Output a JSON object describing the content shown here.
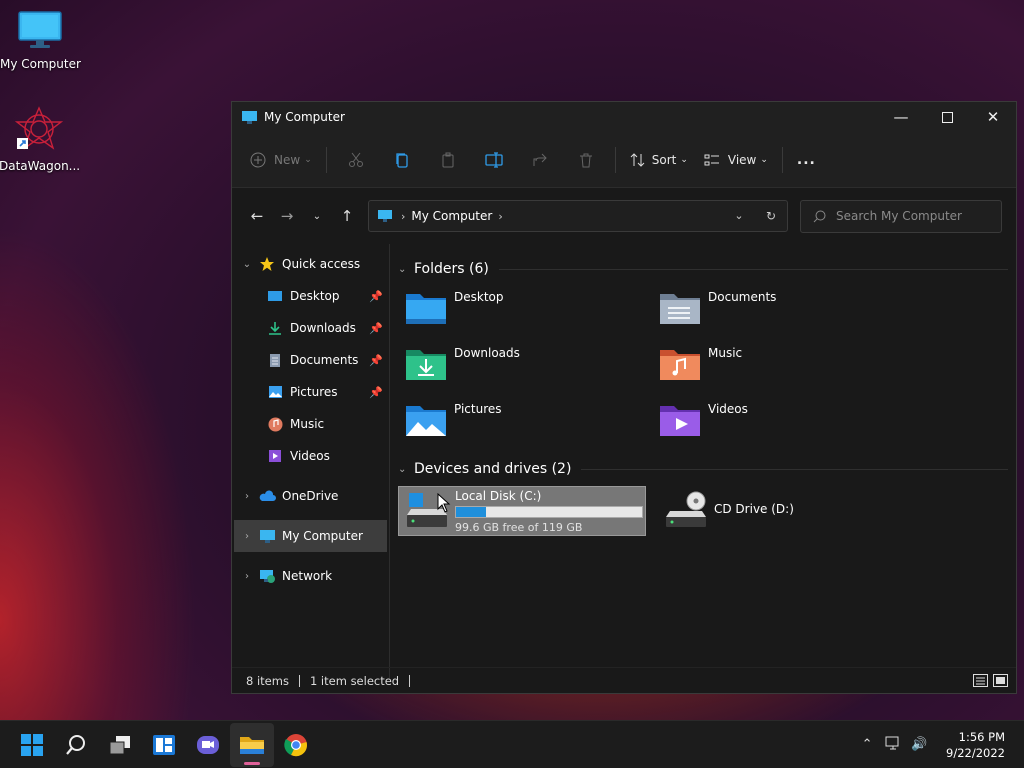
{
  "desktop": {
    "icons": [
      {
        "label": "My Computer",
        "icon": "monitor-icon"
      },
      {
        "label": "DataWagon...",
        "icon": "datawagon-icon"
      }
    ]
  },
  "window": {
    "title": "My Computer",
    "toolbar": {
      "new_label": "New",
      "sort_label": "Sort",
      "view_label": "View",
      "more_label": "..."
    },
    "address": {
      "crumb": "My Computer"
    },
    "search": {
      "placeholder": "Search My Computer"
    },
    "sidebar": {
      "quick_access": "Quick access",
      "quick_items": [
        {
          "label": "Desktop",
          "pinned": true
        },
        {
          "label": "Downloads",
          "pinned": true
        },
        {
          "label": "Documents",
          "pinned": true
        },
        {
          "label": "Pictures",
          "pinned": true
        },
        {
          "label": "Music",
          "pinned": false
        },
        {
          "label": "Videos",
          "pinned": false
        }
      ],
      "onedrive": "OneDrive",
      "my_computer": "My Computer",
      "network": "Network"
    },
    "content": {
      "folders_header": "Folders (6)",
      "folders": [
        {
          "label": "Desktop"
        },
        {
          "label": "Documents"
        },
        {
          "label": "Downloads"
        },
        {
          "label": "Music"
        },
        {
          "label": "Pictures"
        },
        {
          "label": "Videos"
        }
      ],
      "devices_header": "Devices and drives (2)",
      "drives": [
        {
          "label": "Local Disk (C:)",
          "free_text": "99.6 GB free of 119 GB",
          "used_fraction": 0.163
        },
        {
          "label": "CD Drive (D:)"
        }
      ]
    },
    "status": {
      "items": "8 items",
      "selected": "1 item selected"
    }
  },
  "taskbar": {
    "time": "1:56 PM",
    "date": "9/22/2022"
  },
  "colors": {
    "accent": "#1f8fdb",
    "selection": "#3d3d3d"
  }
}
